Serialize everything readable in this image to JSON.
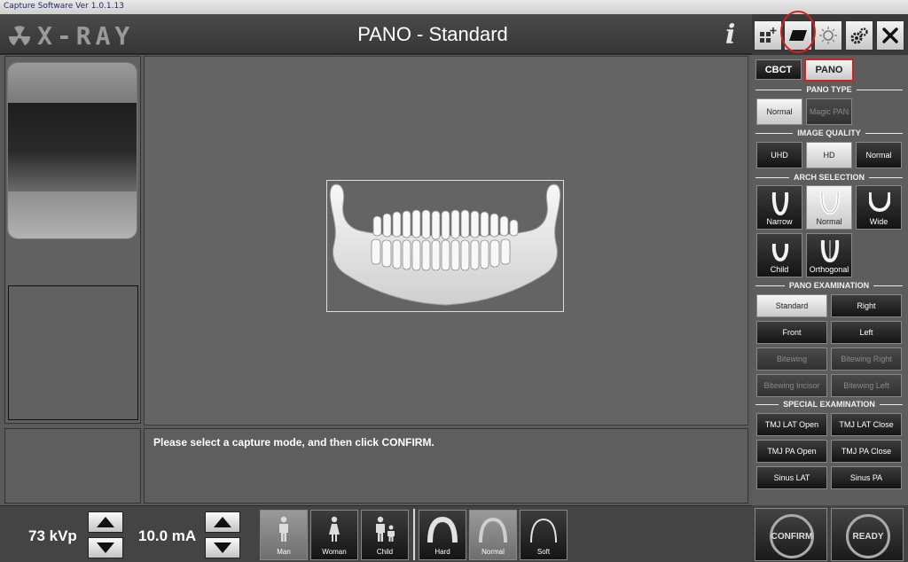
{
  "window": {
    "title": "Capture Software Ver 1.0.1.13"
  },
  "header": {
    "logo_text": "X-RAY",
    "title": "PANO - Standard",
    "info_glyph": "i"
  },
  "toolbar": {
    "tools": [
      {
        "name": "grid-add-icon"
      },
      {
        "name": "film-icon"
      },
      {
        "name": "brightness-icon"
      },
      {
        "name": "settings-icon"
      },
      {
        "name": "close-icon"
      }
    ]
  },
  "modes": {
    "cbct": "CBCT",
    "pano": "PANO",
    "selected": "PANO"
  },
  "pano_type": {
    "title": "PANO TYPE",
    "normal": "Normal",
    "magic": "Magic PAN"
  },
  "image_quality": {
    "title": "IMAGE QUALITY",
    "uhd": "UHD",
    "hd": "HD",
    "normal": "Normal"
  },
  "arch_selection": {
    "title": "ARCH SELECTION",
    "narrow": "Narrow",
    "normal": "Normal",
    "wide": "Wide",
    "child": "Child",
    "orthogonal": "Orthogonal"
  },
  "pano_exam": {
    "title": "PANO EXAMINATION",
    "standard": "Standard",
    "right": "Right",
    "front": "Front",
    "left": "Left",
    "bitewing": "Bitewing",
    "bitewing_right": "Bitewing Right",
    "bitewing_incisor": "Bitewing Incisor",
    "bitewing_left": "Bitewing Left"
  },
  "special_exam": {
    "title": "SPECIAL EXAMINATION",
    "tmj_lat_open": "TMJ LAT Open",
    "tmj_lat_close": "TMJ LAT Close",
    "tmj_pa_open": "TMJ PA Open",
    "tmj_pa_close": "TMJ PA Close",
    "sinus_lat": "Sinus LAT",
    "sinus_pa": "Sinus PA"
  },
  "message": {
    "text": "Please select a capture mode, and then click CONFIRM."
  },
  "exposure": {
    "kvp": "73 kVp",
    "ma": "10.0 mA"
  },
  "patient": {
    "man": "Man",
    "woman": "Woman",
    "child": "Child"
  },
  "density": {
    "hard": "Hard",
    "normal": "Normal",
    "soft": "Soft"
  },
  "actions": {
    "confirm": "CONFIRM",
    "ready": "READY"
  },
  "colors": {
    "highlight": "#d81e1e",
    "panel": "#5d5d5d"
  }
}
